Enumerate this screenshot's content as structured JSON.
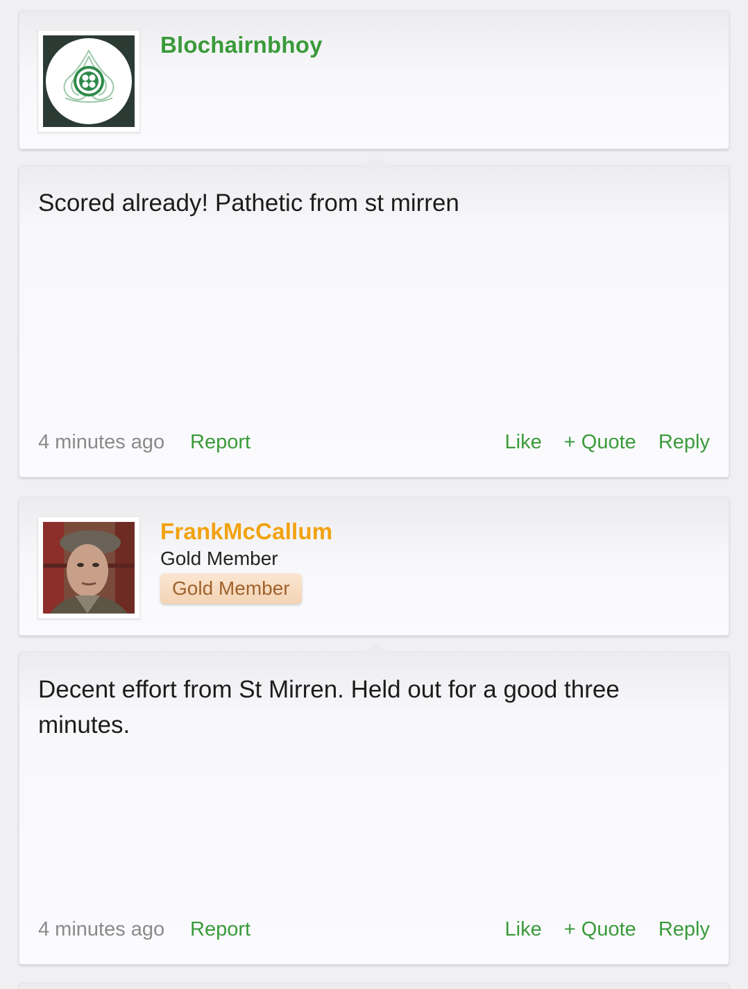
{
  "posts": [
    {
      "username": "Blochairnbhoy",
      "username_color": "#3a9a3a",
      "avatar": "celtic-crest-icon",
      "text": "Scored already! Pathetic from st mirren",
      "time": "4 minutes ago",
      "report": "Report",
      "like": "Like",
      "quote": "+ Quote",
      "reply": "Reply"
    },
    {
      "username": "FrankMcCallum",
      "username_color": "#f2a20f",
      "avatar": "user-photo",
      "user_title": "Gold Member",
      "badge": "Gold Member",
      "text": "Decent effort from St Mirren. Held out for a good three minutes.",
      "time": "4 minutes ago",
      "report": "Report",
      "like": "Like",
      "quote": "+ Quote",
      "reply": "Reply"
    }
  ]
}
